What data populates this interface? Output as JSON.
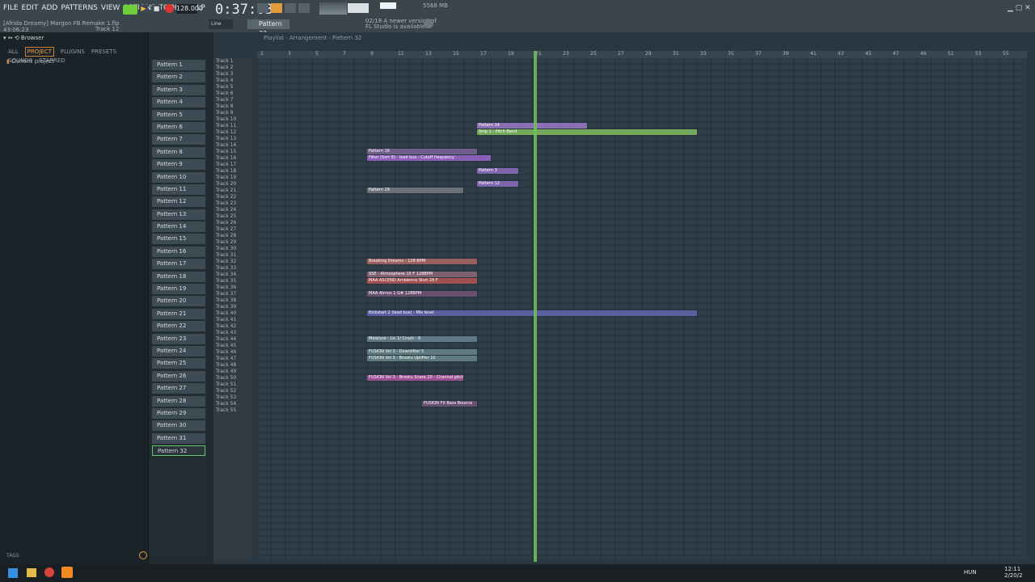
{
  "menu": [
    "FILE",
    "EDIT",
    "ADD",
    "PATTERNS",
    "VIEW",
    "OPTIONS",
    "TOOLS",
    "HELP"
  ],
  "project_line": "[Afrida Dreamy] Margon FB Remake 1.flp",
  "track_label": "Track 12",
  "time_small": "43:06:23",
  "bpm": "128.000",
  "time": "0:37:03",
  "pattern_name": "Pattern 32",
  "snap": "Line",
  "news": {
    "line1": "02/18  A newer version of",
    "line2": "FL Studio is available!"
  },
  "cpu": "5568 MB",
  "browser": {
    "title": "Browser",
    "tabs": [
      "ALL",
      "PROJECT",
      "PLUGINS",
      "PRESETS",
      "SOUNDS",
      "STARRED"
    ],
    "item": "Current project",
    "tags": "TAGS"
  },
  "playlist_title": "Playlist - Arrangement - Pattern 32",
  "patterns": [
    "Pattern 1",
    "Pattern 2",
    "Pattern 3",
    "Pattern 4",
    "Pattern 5",
    "Pattern 6",
    "Pattern 7",
    "Pattern 8",
    "Pattern 9",
    "Pattern 10",
    "Pattern 11",
    "Pattern 12",
    "Pattern 13",
    "Pattern 14",
    "Pattern 15",
    "Pattern 16",
    "Pattern 17",
    "Pattern 18",
    "Pattern 19",
    "Pattern 20",
    "Pattern 21",
    "Pattern 22",
    "Pattern 23",
    "Pattern 24",
    "Pattern 25",
    "Pattern 26",
    "Pattern 27",
    "Pattern 28",
    "Pattern 29",
    "Pattern 30",
    "Pattern 31",
    "Pattern 32"
  ],
  "tracks": [
    "Track 1",
    "Track 2",
    "Track 3",
    "Track 4",
    "Track 5",
    "Track 6",
    "Track 7",
    "Track 8",
    "Track 9",
    "Track 10",
    "Track 11",
    "Track 12",
    "Track 13",
    "Track 14",
    "Track 15",
    "Track 16",
    "Track 17",
    "Track 18",
    "Track 19",
    "Track 20",
    "Track 21",
    "Track 22",
    "Track 23",
    "Track 24",
    "Track 25",
    "Track 26",
    "Track 27",
    "Track 28",
    "Track 29",
    "Track 30",
    "Track 31",
    "Track 32",
    "Track 33",
    "Track 34",
    "Track 35",
    "Track 36",
    "Track 37",
    "Track 38",
    "Track 39",
    "Track 40",
    "Track 41",
    "Track 42",
    "Track 43",
    "Track 44",
    "Track 45",
    "Track 46",
    "Track 47",
    "Track 48",
    "Track 49",
    "Track 50",
    "Track 51",
    "Track 52",
    "Track 53",
    "Track 54",
    "Track 55"
  ],
  "ruler": [
    "1",
    "3",
    "5",
    "7",
    "9",
    "11",
    "13",
    "15",
    "17",
    "19",
    "21",
    "23",
    "25",
    "27",
    "29",
    "31",
    "33",
    "35",
    "37",
    "39",
    "41",
    "43",
    "45",
    "47",
    "49",
    "51",
    "53",
    "55"
  ],
  "clips": [
    {
      "row": 11,
      "bar": 17,
      "len": 8,
      "label": "Pattern 14",
      "color": "#8a6fb5"
    },
    {
      "row": 12,
      "bar": 17,
      "len": 16,
      "label": "Snip 1 - Pitch Bend",
      "color": "#74a85a"
    },
    {
      "row": 15,
      "bar": 9,
      "len": 8,
      "label": "Pattern 16",
      "color": "#6f5f8a"
    },
    {
      "row": 16,
      "bar": 9,
      "len": 9,
      "label": "Filter (Sort 8) - lead bus - Cutoff frequency",
      "color": "#8a5fb8"
    },
    {
      "row": 18,
      "bar": 17,
      "len": 3,
      "label": "Pattern 3",
      "color": "#7e66ad"
    },
    {
      "row": 20,
      "bar": 17,
      "len": 3,
      "label": "Pattern 12",
      "color": "#7e66ad"
    },
    {
      "row": 21,
      "bar": 9,
      "len": 7,
      "label": "Pattern 29",
      "color": "#6a6f78"
    },
    {
      "row": 32,
      "bar": 9,
      "len": 8,
      "label": "Breaking Dreams - 128 BPM",
      "color": "#9a6060"
    },
    {
      "row": 34,
      "bar": 9,
      "len": 8,
      "label": "SSE - Atmosphere 15 F 128BPM",
      "color": "#7f6070"
    },
    {
      "row": 35,
      "bar": 9,
      "len": 8,
      "label": "MAA ASCEND Ambience Shot 28 F",
      "color": "#a05050"
    },
    {
      "row": 37,
      "bar": 9,
      "len": 8,
      "label": "MAA Atmos 1 G# 128BPM",
      "color": "#6a5070"
    },
    {
      "row": 40,
      "bar": 9,
      "len": 24,
      "label": "Kickstart 2 (lead bus) - Mix level",
      "color": "#5b5fa0"
    },
    {
      "row": 44,
      "bar": 9,
      "len": 8,
      "label": "Moisture - Lic 1/ Crush - 6",
      "color": "#5f7a86"
    },
    {
      "row": 46,
      "bar": 9,
      "len": 8,
      "label": "FUSION Vol 3 - Downlifter 5",
      "color": "#5c7a7f"
    },
    {
      "row": 47,
      "bar": 9,
      "len": 8,
      "label": "FUSION Vol 3 - Brooks Uplifter 10",
      "color": "#5c7a7f"
    },
    {
      "row": 50,
      "bar": 9,
      "len": 7,
      "label": "FUSION Vol 3 - Brooks Snare 20 - Channel pitch",
      "color": "#9a5090"
    },
    {
      "row": 54,
      "bar": 13,
      "len": 4,
      "label": "FUSION FX Bass Bounce",
      "color": "#6a5070"
    }
  ],
  "taskbar": {
    "lang": "HUN",
    "clock": "12:11",
    "date": "2/20/2"
  }
}
